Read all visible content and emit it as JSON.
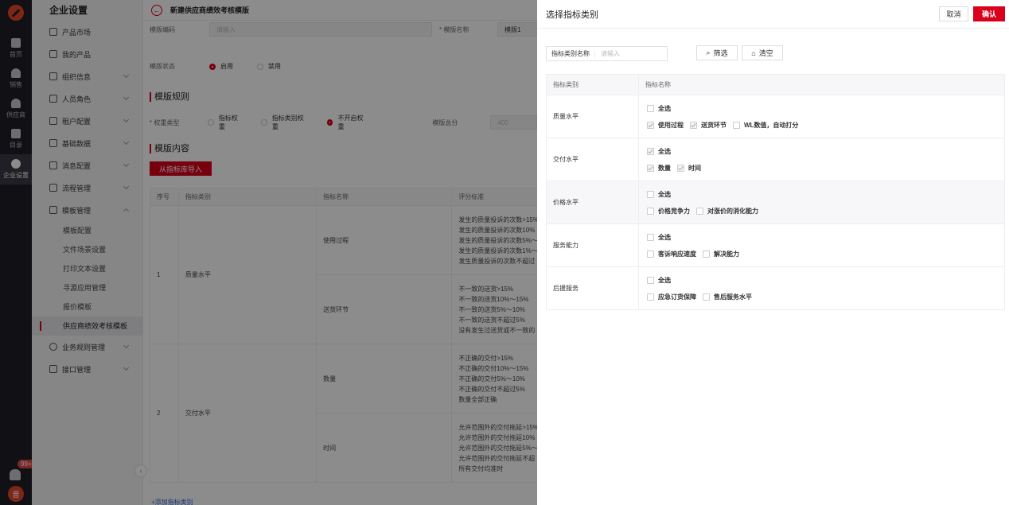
{
  "rail": {
    "items": [
      {
        "label": "首页",
        "icon": "home-icon"
      },
      {
        "label": "销售",
        "icon": "person-icon"
      },
      {
        "label": "供应商",
        "icon": "person-icon"
      },
      {
        "label": "目录",
        "icon": "book-icon"
      },
      {
        "label": "企业设置",
        "icon": "gear-icon",
        "active": true
      }
    ],
    "notification_count": "99+",
    "avatar_text": "晋"
  },
  "sidebar": {
    "title": "企业设置",
    "items": [
      {
        "label": "产品市场",
        "icon": "market-icon"
      },
      {
        "label": "我的产品",
        "icon": "box-icon"
      },
      {
        "label": "组织信息",
        "icon": "building-icon",
        "expandable": true
      },
      {
        "label": "人员角色",
        "icon": "users-icon",
        "expandable": true
      },
      {
        "label": "租户配置",
        "icon": "tenant-icon",
        "expandable": true
      },
      {
        "label": "基础数据",
        "icon": "grid-icon",
        "expandable": true
      },
      {
        "label": "消息配置",
        "icon": "message-icon",
        "expandable": true
      },
      {
        "label": "流程管理",
        "icon": "flow-icon",
        "expandable": true
      },
      {
        "label": "模板管理",
        "icon": "template-icon",
        "expanded": true
      }
    ],
    "template_sub": [
      "模板配置",
      "文件场景设置",
      "打印文本设置",
      "寻源应用管理",
      "报价模板",
      "供应商绩效考核模板"
    ],
    "items_after": [
      {
        "label": "业务规则管理",
        "icon": "gear-icon"
      },
      {
        "label": "接口管理",
        "icon": "plug-icon"
      }
    ]
  },
  "main": {
    "breadcrumb": "新建供应商绩效考核模版",
    "code_label": "模版编码",
    "code_placeholder": "请输入",
    "name_label": "* 模版名称",
    "name_value": "模版1",
    "status_label": "模版状态",
    "status_on": "启用",
    "status_off": "禁用",
    "rules_title": "模版规则",
    "weight_label": "* 权重类型",
    "weight_options": [
      "指标权重",
      "指标类别权重",
      "不开启权重"
    ],
    "total_label": "模版总分",
    "total_value": "400",
    "content_title": "模版内容",
    "import_button": "从指标库导入",
    "table_headers": [
      "序号",
      "指标类别",
      "指标名称",
      "评分标准"
    ],
    "rows": [
      {
        "no": "1",
        "category": "质量水平",
        "items": [
          {
            "name": "使用过程",
            "criteria": [
              "发生的质量投诉的次数>15%",
              "发生的质量投诉的次数10%",
              "发生的质量投诉的次数5%～",
              "发生的质量投诉的次数1%～",
              "发生质量投诉的次数不超过"
            ]
          },
          {
            "name": "送货环节",
            "criteria": [
              "不一致的送货>15%",
              "不一致的送货10%～15%",
              "不一致的送货5%～10%",
              "不一致的送货不超过5%",
              "没有发生过送货或不一致的"
            ]
          }
        ]
      },
      {
        "no": "2",
        "category": "交付水平",
        "items": [
          {
            "name": "数量",
            "criteria": [
              "不正确的交付>15%",
              "不正确的交付10%～15%",
              "不正确的交付5%～10%",
              "不正确的交付不超过5%",
              "数量全部正确"
            ]
          },
          {
            "name": "时间",
            "criteria": [
              "允许范围外的交付拖延>15%",
              "允许范围外的交付拖延10%",
              "允许范围外的交付拖延5%～",
              "允许范围外的交付拖延不超",
              "所有交付均准时"
            ]
          }
        ]
      }
    ],
    "add_link": "+添加指标类别"
  },
  "drawer": {
    "title": "选择指标类别",
    "cancel": "取消",
    "confirm": "确认",
    "filter_label": "指标类别名称",
    "filter_placeholder": "请输入",
    "filter_button": "筛选",
    "clear_button": "清空",
    "headers": [
      "指标类别",
      "指标名称"
    ],
    "select_all": "全选",
    "groups": [
      {
        "category": "质量水平",
        "all_checked": false,
        "items": [
          {
            "label": "使用过程",
            "checked": true
          },
          {
            "label": "送货环节",
            "checked": true
          },
          {
            "label": "WL数值，自动打分",
            "checked": false
          }
        ]
      },
      {
        "category": "交付水平",
        "all_checked": true,
        "items": [
          {
            "label": "数量",
            "checked": true
          },
          {
            "label": "时间",
            "checked": true
          }
        ]
      },
      {
        "category": "价格水平",
        "all_checked": false,
        "items": [
          {
            "label": "价格竞争力",
            "checked": false
          },
          {
            "label": "对涨价的消化能力",
            "checked": false
          }
        ]
      },
      {
        "category": "服务能力",
        "all_checked": false,
        "items": [
          {
            "label": "客诉响应速度",
            "checked": false
          },
          {
            "label": "解决能力",
            "checked": false
          }
        ]
      },
      {
        "category": "后援服务",
        "all_checked": false,
        "items": [
          {
            "label": "应急订货保障",
            "checked": false
          },
          {
            "label": "售后服务水平",
            "checked": false
          }
        ]
      }
    ]
  },
  "colors": {
    "accent": "#d9001b",
    "rail": "#1f1f27"
  }
}
